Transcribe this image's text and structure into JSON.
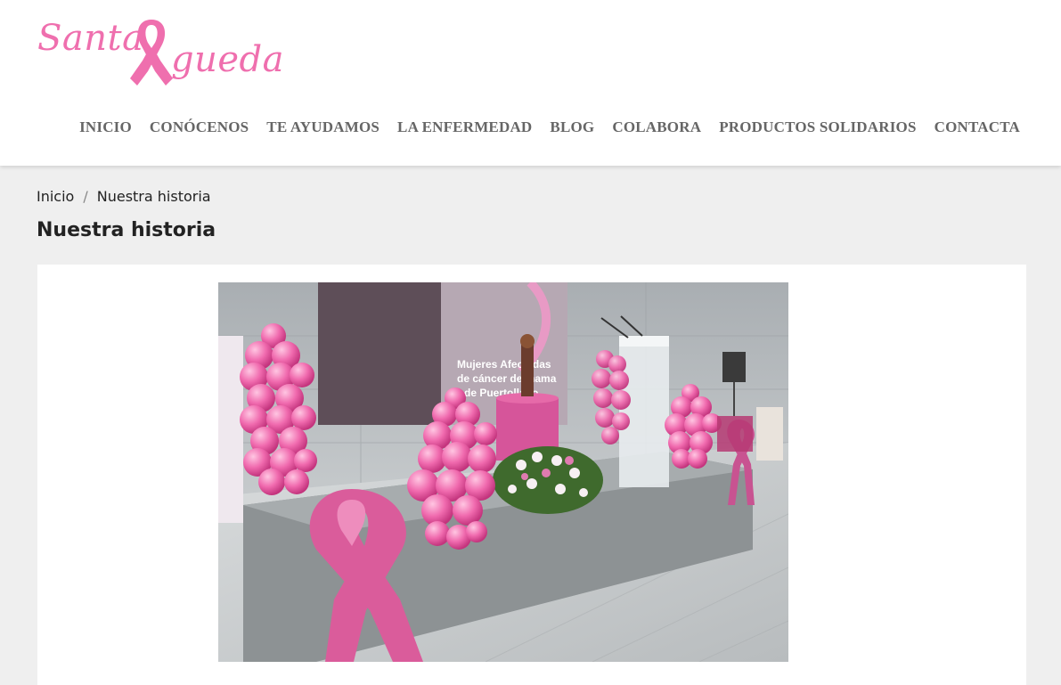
{
  "logo": {
    "text_part1": "Santa",
    "text_part2": "gueda",
    "brand_color": "#ef6fae",
    "icon": "pink-ribbon-icon"
  },
  "nav": {
    "items": [
      {
        "label": "INICIO"
      },
      {
        "label": "CONÓCENOS"
      },
      {
        "label": "TE AYUDAMOS"
      },
      {
        "label": "LA ENFERMEDAD"
      },
      {
        "label": "BLOG"
      },
      {
        "label": "COLABORA"
      },
      {
        "label": "PRODUCTOS SOLIDARIOS"
      },
      {
        "label": "CONTACTA"
      }
    ]
  },
  "breadcrumb": {
    "home": "Inicio",
    "separator": "/",
    "current": "Nuestra historia"
  },
  "page": {
    "title": "Nuestra historia"
  },
  "photo": {
    "banner_text_line1": "Mujeres Afectadas",
    "banner_text_line2": "de cáncer de mama",
    "banner_text_line3": "de Puertollano"
  },
  "colors": {
    "page_background": "#efefef",
    "nav_text": "#666666",
    "heading_text": "#222222"
  }
}
